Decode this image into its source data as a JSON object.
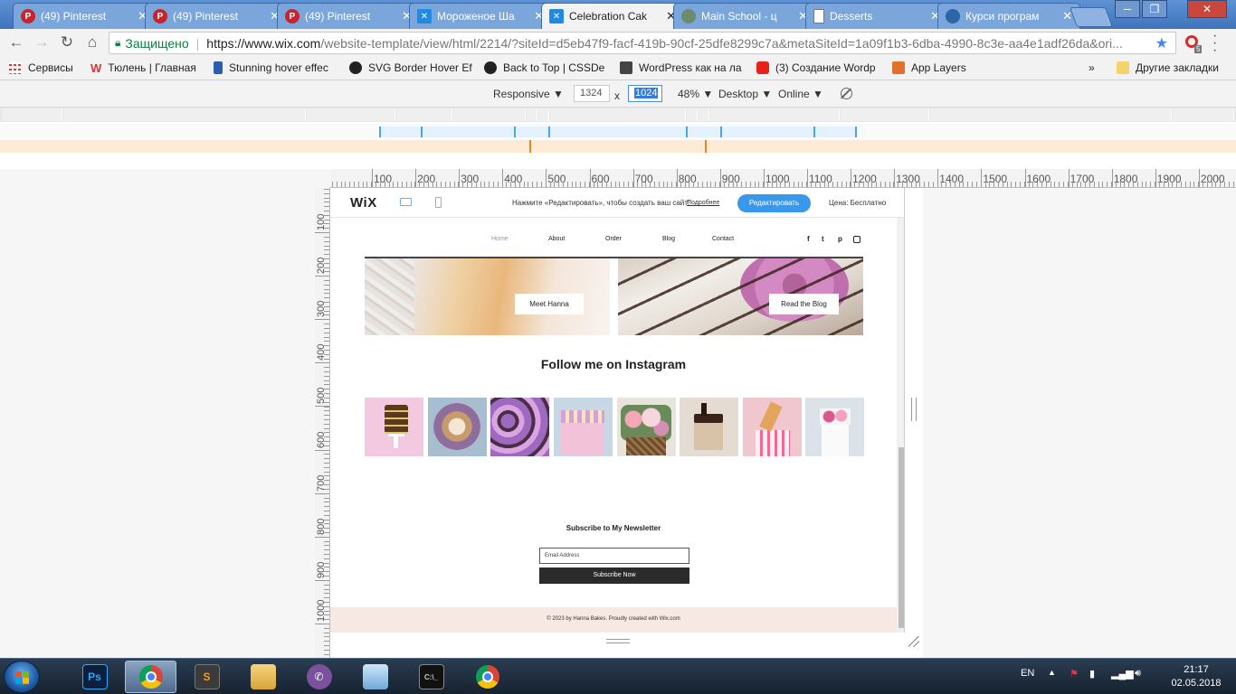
{
  "browser": {
    "tabs": [
      {
        "title": "(49) Pinterest",
        "icon": "pinterest-icon"
      },
      {
        "title": "(49) Pinterest",
        "icon": "pinterest-icon"
      },
      {
        "title": "(49) Pinterest",
        "icon": "pinterest-icon"
      },
      {
        "title": "Мороженое Ша",
        "icon": "wix-icon"
      },
      {
        "title": "Celebration Cak",
        "icon": "wix-icon",
        "active": true
      },
      {
        "title": "Main School - ц",
        "icon": "globe-icon"
      },
      {
        "title": "Desserts",
        "icon": "document-icon"
      },
      {
        "title": "Курси програм",
        "icon": "planet-icon"
      }
    ],
    "tab_close": "✕",
    "window_controls": {
      "minimize": "─",
      "maximize": "❐",
      "close": "✕"
    },
    "address": {
      "secure_label": "Защищено",
      "url_host": "https://www.wix.com",
      "url_rest": "/website-template/view/html/2214/?siteId=d5eb47f9-facf-419b-90cf-25dfe8299c7a&metaSiteId=1a09f1b3-6dba-4990-8c3e-aa4e1adf26da&ori..."
    },
    "extension_badge": "5",
    "bookmarks": [
      {
        "label": "Сервисы",
        "color": "#d23f31"
      },
      {
        "label": "Тюлень | Главная",
        "color": "#e03030"
      },
      {
        "label": "Stunning hover effec",
        "color": "#2a5db0"
      },
      {
        "label": "SVG Border Hover Ef",
        "color": "#222222"
      },
      {
        "label": "Back to Top | CSSDe",
        "color": "#222222"
      },
      {
        "label": "WordPress как на ла",
        "color": "#444444"
      },
      {
        "label": "(3) Создание Wordp",
        "color": "#e62117"
      },
      {
        "label": "App Layers",
        "color": "#e0712a"
      }
    ],
    "bookmarks_more": "»",
    "other_bookmarks": "Другие закладки"
  },
  "devtools": {
    "device": "Responsive",
    "width": "1324",
    "x": "x",
    "height": "1024",
    "zoom": "48%",
    "mode": "Desktop",
    "network": "Online",
    "dropdown_arrow": "▼",
    "ruler_h": [
      "100",
      "200",
      "300",
      "400",
      "500",
      "600",
      "700",
      "800",
      "900",
      "1000",
      "1100",
      "1200",
      "1300",
      "1400",
      "1500",
      "1600",
      "1700",
      "1800",
      "1900",
      "2000"
    ],
    "ruler_v": [
      "100",
      "200",
      "300",
      "400",
      "500",
      "600",
      "700",
      "800",
      "900",
      "1000"
    ]
  },
  "wix_bar": {
    "logo": "WiX",
    "message": "Нажмите «Редактировать», чтобы создать ваш сайт!",
    "more": "Подробнее",
    "edit_button": "Редактировать",
    "price": "Цена: Бесплатно"
  },
  "site": {
    "nav": [
      "Home",
      "About",
      "Order",
      "Blog",
      "Contact"
    ],
    "social": [
      "f",
      "t",
      "p",
      "ig"
    ],
    "card_hanna_button": "Meet Hanna",
    "card_blog_button": "Read the Blog",
    "instagram_title": "Follow me on Instagram",
    "newsletter_title": "Subscribe to My Newsletter",
    "email_placeholder": "Email Address",
    "subscribe_button": "Subscribe Now",
    "footer": "© 2023 by Hanna Bakes. Proudly created with Wix.com"
  },
  "taskbar": {
    "apps": [
      "Photoshop",
      "Chrome",
      "Sublime Text",
      "Explorer",
      "Viber",
      "Control Panel",
      "Command Prompt",
      "Chrome"
    ],
    "language": "EN",
    "time": "21:17",
    "date": "02.05.2018"
  }
}
